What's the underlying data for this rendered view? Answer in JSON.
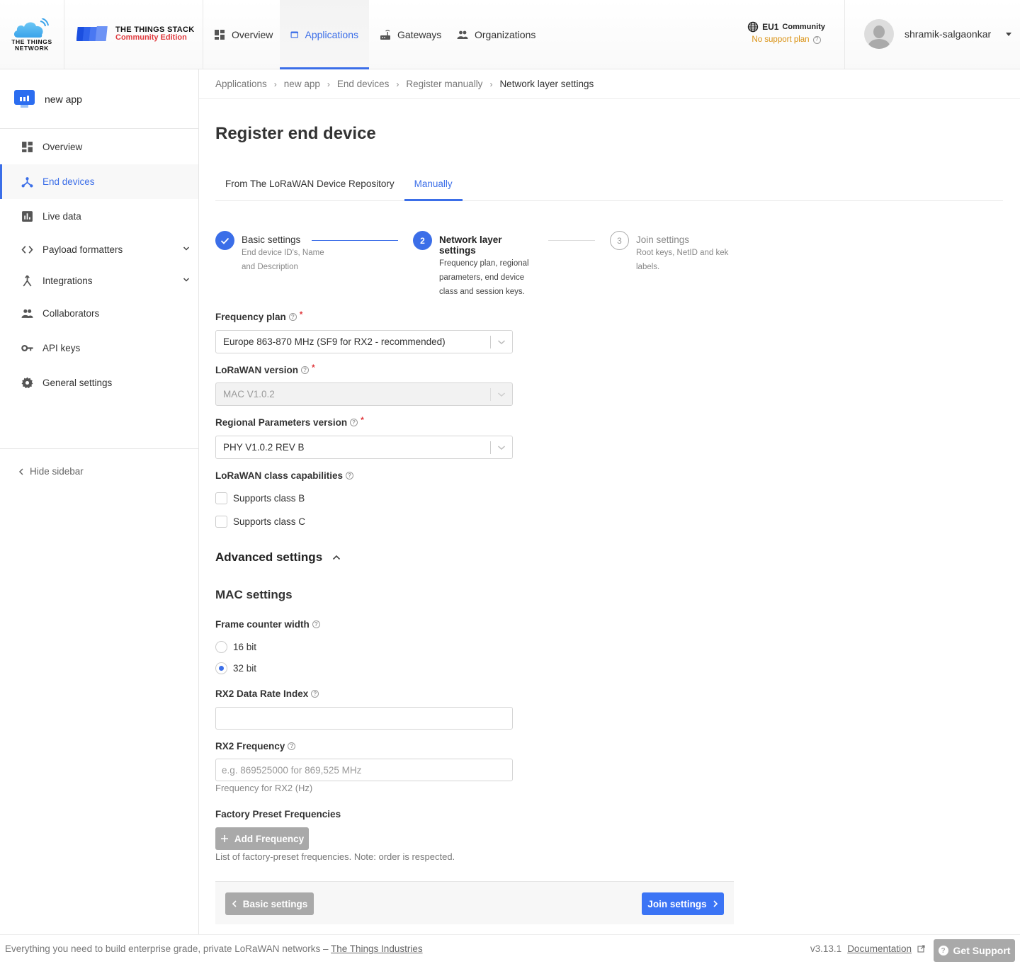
{
  "header": {
    "ttn_logo_text": [
      "THE THINGS",
      "NETWORK"
    ],
    "tts_logo_title": "THE THINGS STACK",
    "tts_logo_subtitle": "Community Edition",
    "nav": [
      {
        "label": "Overview",
        "icon": "dashboard-icon",
        "active": false
      },
      {
        "label": "Applications",
        "icon": "application-window-icon",
        "active": true
      },
      {
        "label": "Gateways",
        "icon": "router-icon",
        "active": false
      },
      {
        "label": "Organizations",
        "icon": "people-icon",
        "active": false
      }
    ],
    "cluster": {
      "name": "EU1",
      "suffix": "Community",
      "support": "No support plan"
    },
    "user": {
      "name": "shramik-salgaonkar"
    }
  },
  "sidebar": {
    "app_name": "new app",
    "items": [
      {
        "label": "Overview",
        "icon": "dashboard-icon"
      },
      {
        "label": "End devices",
        "icon": "device-hub-icon",
        "active": true
      },
      {
        "label": "Live data",
        "icon": "bar-chart-icon"
      },
      {
        "label": "Payload formatters",
        "icon": "code-icon",
        "expandable": true
      },
      {
        "label": "Integrations",
        "icon": "merge-icon",
        "expandable": true
      },
      {
        "label": "Collaborators",
        "icon": "people-icon"
      },
      {
        "label": "API keys",
        "icon": "key-icon"
      },
      {
        "label": "General settings",
        "icon": "gear-icon"
      }
    ],
    "hide_label": "Hide sidebar"
  },
  "breadcrumb": [
    "Applications",
    "new app",
    "End devices",
    "Register manually",
    "Network layer settings"
  ],
  "page": {
    "title": "Register end device",
    "tabs": [
      {
        "label": "From The LoRaWAN Device Repository",
        "active": false
      },
      {
        "label": "Manually",
        "active": true
      }
    ],
    "steps": [
      {
        "num": "1",
        "title": "Basic settings",
        "desc": "End device ID's, Name and Description",
        "state": "done"
      },
      {
        "num": "2",
        "title": "Network layer settings",
        "desc": "Frequency plan, regional parameters, end device class and session keys.",
        "state": "current"
      },
      {
        "num": "3",
        "title": "Join settings",
        "desc": "Root keys, NetID and kek labels.",
        "state": "pending"
      }
    ]
  },
  "form": {
    "frequency_plan": {
      "label": "Frequency plan",
      "value": "Europe 863-870 MHz (SF9 for RX2 - recommended)",
      "required": true
    },
    "lorawan_version": {
      "label": "LoRaWAN version",
      "value": "MAC V1.0.2",
      "required": true,
      "disabled": true
    },
    "regional_params": {
      "label": "Regional Parameters version",
      "value": "PHY V1.0.2 REV B",
      "required": true
    },
    "class_caps": {
      "label": "LoRaWAN class capabilities",
      "options": [
        {
          "label": "Supports class B",
          "checked": false
        },
        {
          "label": "Supports class C",
          "checked": false
        }
      ]
    },
    "advanced_title": "Advanced settings",
    "mac_title": "MAC settings",
    "frame_counter": {
      "label": "Frame counter width",
      "options": [
        {
          "label": "16 bit",
          "selected": false
        },
        {
          "label": "32 bit",
          "selected": true
        }
      ]
    },
    "rx2_dr": {
      "label": "RX2 Data Rate Index",
      "value": "",
      "placeholder": ""
    },
    "rx2_freq": {
      "label": "RX2 Frequency",
      "value": "",
      "placeholder": "e.g. 869525000 for 869,525 MHz",
      "hint": "Frequency for RX2 (Hz)"
    },
    "factory_presets": {
      "label": "Factory Preset Frequencies",
      "button": "Add Frequency",
      "hint": "List of factory-preset frequencies. Note: order is respected."
    },
    "back_button": "Basic settings",
    "next_button": "Join settings"
  },
  "footer": {
    "tagline": "Everything you need to build enterprise grade, private LoRaWAN networks –",
    "tagline_link": "The Things Industries",
    "version": "v3.13.1",
    "docs": "Documentation",
    "support": "Get Support"
  },
  "colors": {
    "accent": "#3b6ee8",
    "warning": "#d9900f",
    "required": "#e03a3e",
    "disabled_button": "#a9a9a9"
  }
}
